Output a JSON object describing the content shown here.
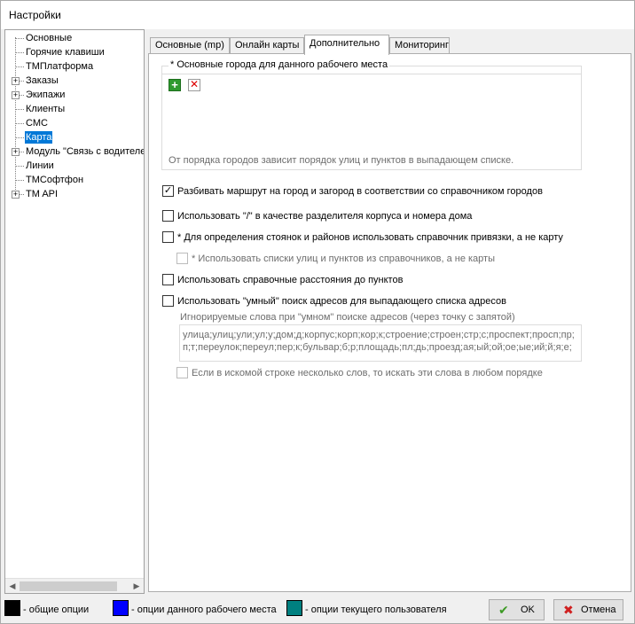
{
  "window": {
    "title": "Настройки"
  },
  "tree": {
    "items": [
      {
        "label": "Основные",
        "expandable": false,
        "selected": false
      },
      {
        "label": "Горячие клавиши",
        "expandable": false,
        "selected": false
      },
      {
        "label": "ТМПлатформа",
        "expandable": false,
        "selected": false
      },
      {
        "label": "Заказы",
        "expandable": true,
        "selected": false
      },
      {
        "label": "Экипажи",
        "expandable": true,
        "selected": false
      },
      {
        "label": "Клиенты",
        "expandable": false,
        "selected": false
      },
      {
        "label": "СМС",
        "expandable": false,
        "selected": false
      },
      {
        "label": "Карта",
        "expandable": false,
        "selected": true
      },
      {
        "label": "Модуль \"Связь с водителем\"",
        "expandable": true,
        "selected": false
      },
      {
        "label": "Линии",
        "expandable": false,
        "selected": false
      },
      {
        "label": "ТМСофтфон",
        "expandable": false,
        "selected": false
      },
      {
        "label": "TM API",
        "expandable": true,
        "selected": false
      }
    ],
    "expander_symbol": "+",
    "scroll_left": "◀",
    "scroll_right": "▶"
  },
  "tabs": [
    {
      "label": "Основные (mp)"
    },
    {
      "label": "Онлайн карты"
    },
    {
      "label": "Дополнительно"
    },
    {
      "label": "Мониторинг"
    }
  ],
  "active_tab": "Дополнительно",
  "cities": {
    "title": "* Основные города для данного рабочего места",
    "add_icon": "+",
    "delete_icon": "✕",
    "hint": "От порядка городов зависит порядок улиц и пунктов в выпадающем списке."
  },
  "options": {
    "split_route": {
      "label": "Разбивать маршрут на город и загород в соответствии со справочником  городов",
      "checked": true
    },
    "slash_separator": {
      "label": "Использовать \"/\" в качестве разделителя корпуса и номера дома",
      "checked": false
    },
    "binding_directory": {
      "label": "* Для определения стоянок и районов использовать справочник привязки, а не карту",
      "checked": false
    },
    "street_lists": {
      "label": "* Использовать списки улиц и пунктов из справочников, а не карты",
      "checked": false
    },
    "reference_distances": {
      "label": "Использовать справочные расстояния до пунктов",
      "checked": false
    },
    "smart_search": {
      "label": "Использовать \"умный\" поиск адресов для выпадающего списка адресов",
      "checked": false
    },
    "any_order": {
      "label": "Если в искомой строке несколько слов, то искать эти слова в любом порядке",
      "checked": false
    }
  },
  "check_mark": "✓",
  "ignored_words": {
    "label": "Игнорируемые слова  при \"умном\" поиске адресов (через точку с запятой)",
    "value": "улица;улиц;ули;ул;у;дом;д;корпус;корп;кор;к;строение;строен;стр;с;проспект;просп;пр;п;т;переулок;переул;пер;к;бульвар;б;р;площадь;пл;дь;проезд;ая;ый;ой;ое;ые;ий;й;я;е;"
  },
  "legend": [
    {
      "label": "- общие опции",
      "color": "#000000"
    },
    {
      "label": "- опции данного рабочего места",
      "color": "#0000ff"
    },
    {
      "label": "- опции текущего пользователя",
      "color": "#008080"
    }
  ],
  "buttons": {
    "ok": {
      "label": "OK",
      "icon": "✔"
    },
    "cancel": {
      "label": "Отмена",
      "icon": "✖"
    }
  }
}
